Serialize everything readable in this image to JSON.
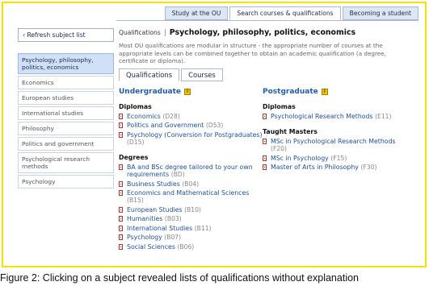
{
  "top_tabs": [
    {
      "label": "Study at the OU",
      "active": false
    },
    {
      "label": "Search courses & qualifications",
      "active": true
    },
    {
      "label": "Becoming a student",
      "active": false
    }
  ],
  "sidebar": {
    "refresh_label": "‹ Refresh subject list",
    "subjects": [
      {
        "label": "Psychology, philosophy, politics, economics",
        "active": true
      },
      {
        "label": "Economics",
        "active": false
      },
      {
        "label": "European studies",
        "active": false
      },
      {
        "label": "International studies",
        "active": false
      },
      {
        "label": "Philosophy",
        "active": false
      },
      {
        "label": "Politics and government",
        "active": false
      },
      {
        "label": "Psychological research methods",
        "active": false
      },
      {
        "label": "Psychology",
        "active": false
      }
    ]
  },
  "main": {
    "crumb": "Qualifications",
    "title": "Psychology, philosophy, politics, economics",
    "intro": "Most OU qualifications are modular in structure - the appropriate number of courses at the appropriate levels can be combined together to obtain an academic qualification (a degree, certificate or diploma).",
    "tabs": [
      {
        "label": "Qualifications",
        "active": true
      },
      {
        "label": "Courses",
        "active": false
      }
    ]
  },
  "undergraduate": {
    "heading": "Undergraduate",
    "diplomas_heading": "Diplomas",
    "diplomas": [
      {
        "name": "Economics",
        "code": "(D28)"
      },
      {
        "name": "Politics and Government",
        "code": "(D53)"
      },
      {
        "name": "Psychology (Conversion for Postgraduates)",
        "code": "(D15)"
      }
    ],
    "degrees_heading": "Degrees",
    "degrees": [
      {
        "name": "BA and BSc degree tailored to your own requirements",
        "code": "(BD)"
      },
      {
        "name": "Business Studies",
        "code": "(B04)"
      },
      {
        "name": "Economics and Mathematical Sciences",
        "code": "(B15)"
      },
      {
        "name": "European Studies",
        "code": "(B10)"
      },
      {
        "name": "Humanities",
        "code": "(B03)"
      },
      {
        "name": "International Studies",
        "code": "(B11)"
      },
      {
        "name": "Psychology",
        "code": "(B07)"
      },
      {
        "name": "Social Sciences",
        "code": "(B06)"
      }
    ]
  },
  "postgraduate": {
    "heading": "Postgraduate",
    "diplomas_heading": "Diplomas",
    "diplomas": [
      {
        "name": "Psychological Research Methods",
        "code": "(E11)"
      }
    ],
    "masters_heading": "Taught Masters",
    "masters": [
      {
        "name": "MSc in Psychological Research Methods",
        "code": "(F20)"
      },
      {
        "name": "MSc in Psychology",
        "code": "(F15)"
      },
      {
        "name": "Master of Arts in Philosophy",
        "code": "(F30)"
      }
    ]
  },
  "info_icon_glyph": "i",
  "caption": "Figure 2: Clicking on a subject revealed lists of qualifications without explanation",
  "colors": {
    "link": "#1d4f9e",
    "heading": "#1d5fae",
    "frame": "#f2e400",
    "active_subject": "#cfe0f7"
  }
}
